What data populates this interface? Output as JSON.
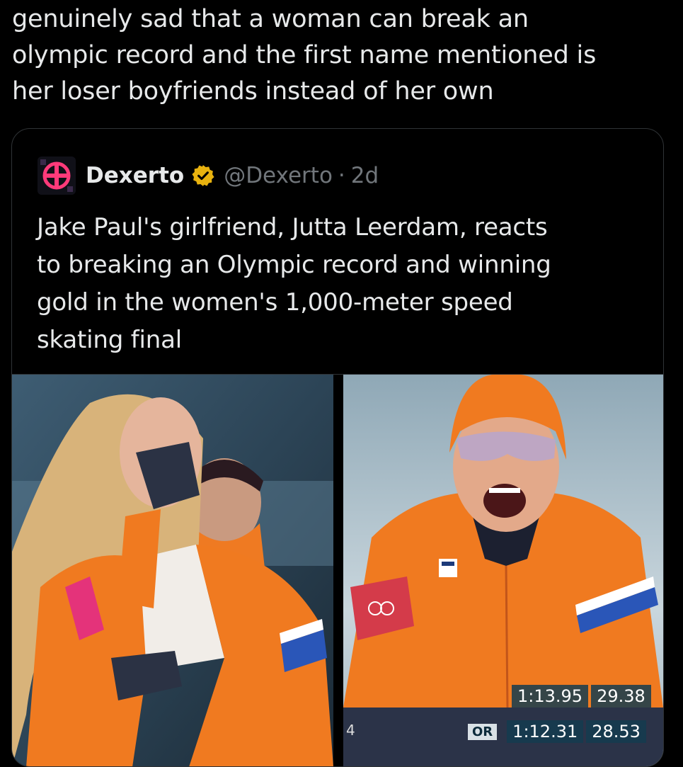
{
  "tweet": {
    "text": "genuinely sad that a woman can break an\nolympic record and the first name mentioned is\nher loser boyfriends instead of her own"
  },
  "quote": {
    "author_name": "Dexerto",
    "handle": "@Dexerto",
    "separator": "·",
    "age": "2d",
    "text": "Jake Paul's girlfriend, Jutta Leerdam, reacts\nto breaking an Olympic record and winning\ngold in the women's 1,000-meter speed\nskating final"
  },
  "scoreboard": {
    "row1": {
      "time": "1:13.95",
      "split": "29.38"
    },
    "row2": {
      "badge": "OR",
      "time": "1:12.31",
      "split": "28.53",
      "lane": "4"
    }
  },
  "colors": {
    "background": "#000000",
    "text": "#e7e9ea",
    "muted": "#71767b",
    "verified_gold": "#e8b20f",
    "skinsuit_orange": "#f07a20"
  },
  "icons": {
    "avatar": "dexerto-logo-icon",
    "verified": "verified-badge-icon"
  }
}
